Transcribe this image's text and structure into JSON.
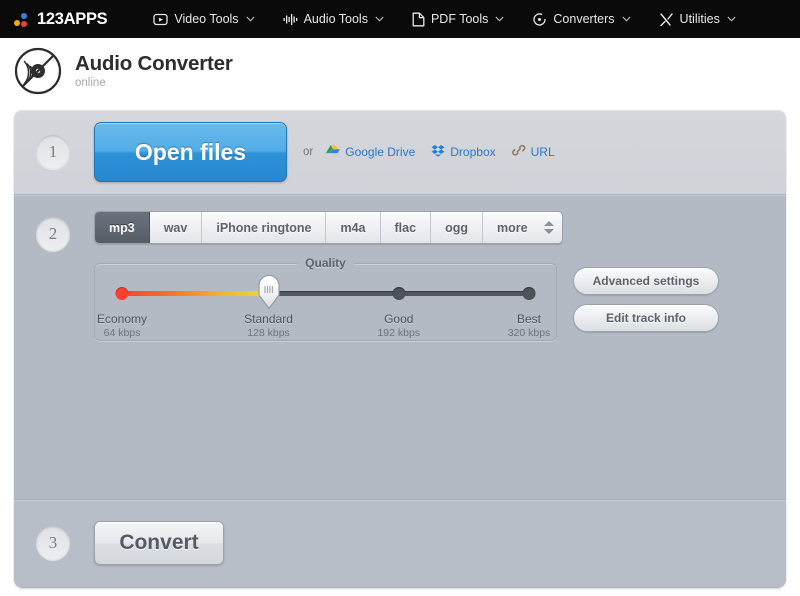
{
  "navbar": {
    "brand": "123APPS",
    "items": [
      {
        "label": "Video Tools",
        "icon": "play-box-icon"
      },
      {
        "label": "Audio Tools",
        "icon": "waveform-icon"
      },
      {
        "label": "PDF Tools",
        "icon": "document-icon"
      },
      {
        "label": "Converters",
        "icon": "convert-circle-icon"
      },
      {
        "label": "Utilities",
        "icon": "tools-cross-icon"
      }
    ]
  },
  "header": {
    "title": "Audio Converter",
    "subtitle": "online",
    "logo_icon": "vinyl-record-icon"
  },
  "step1": {
    "number": "1",
    "open_files_label": "Open files",
    "or_label": "or",
    "sources": [
      {
        "label": "Google Drive",
        "icon": "google-drive-icon"
      },
      {
        "label": "Dropbox",
        "icon": "dropbox-icon"
      },
      {
        "label": "URL",
        "icon": "link-icon"
      }
    ]
  },
  "step2": {
    "number": "2",
    "formats": [
      {
        "label": "mp3",
        "active": true
      },
      {
        "label": "wav",
        "active": false
      },
      {
        "label": "iPhone ringtone",
        "active": false
      },
      {
        "label": "m4a",
        "active": false
      },
      {
        "label": "flac",
        "active": false
      },
      {
        "label": "ogg",
        "active": false
      },
      {
        "label": "more",
        "active": false
      }
    ],
    "quality": {
      "legend": "Quality",
      "selected_index": 1,
      "stops": [
        {
          "name": "Economy",
          "bitrate": "64 kbps",
          "pos": 0
        },
        {
          "name": "Standard",
          "bitrate": "128 kbps",
          "pos": 36
        },
        {
          "name": "Good",
          "bitrate": "192 kbps",
          "pos": 68
        },
        {
          "name": "Best",
          "bitrate": "320 kbps",
          "pos": 100
        }
      ]
    },
    "side_buttons": [
      {
        "label": "Advanced settings"
      },
      {
        "label": "Edit track info"
      }
    ]
  },
  "step3": {
    "number": "3",
    "convert_label": "Convert"
  },
  "colors": {
    "navbar_bg": "#0a0a0a",
    "panel_bg": "#b3bac3",
    "primary_button": "#3f9ddd",
    "link": "#2b77c6",
    "slider_low": "#f8402e",
    "slider_track": "#53575d"
  }
}
